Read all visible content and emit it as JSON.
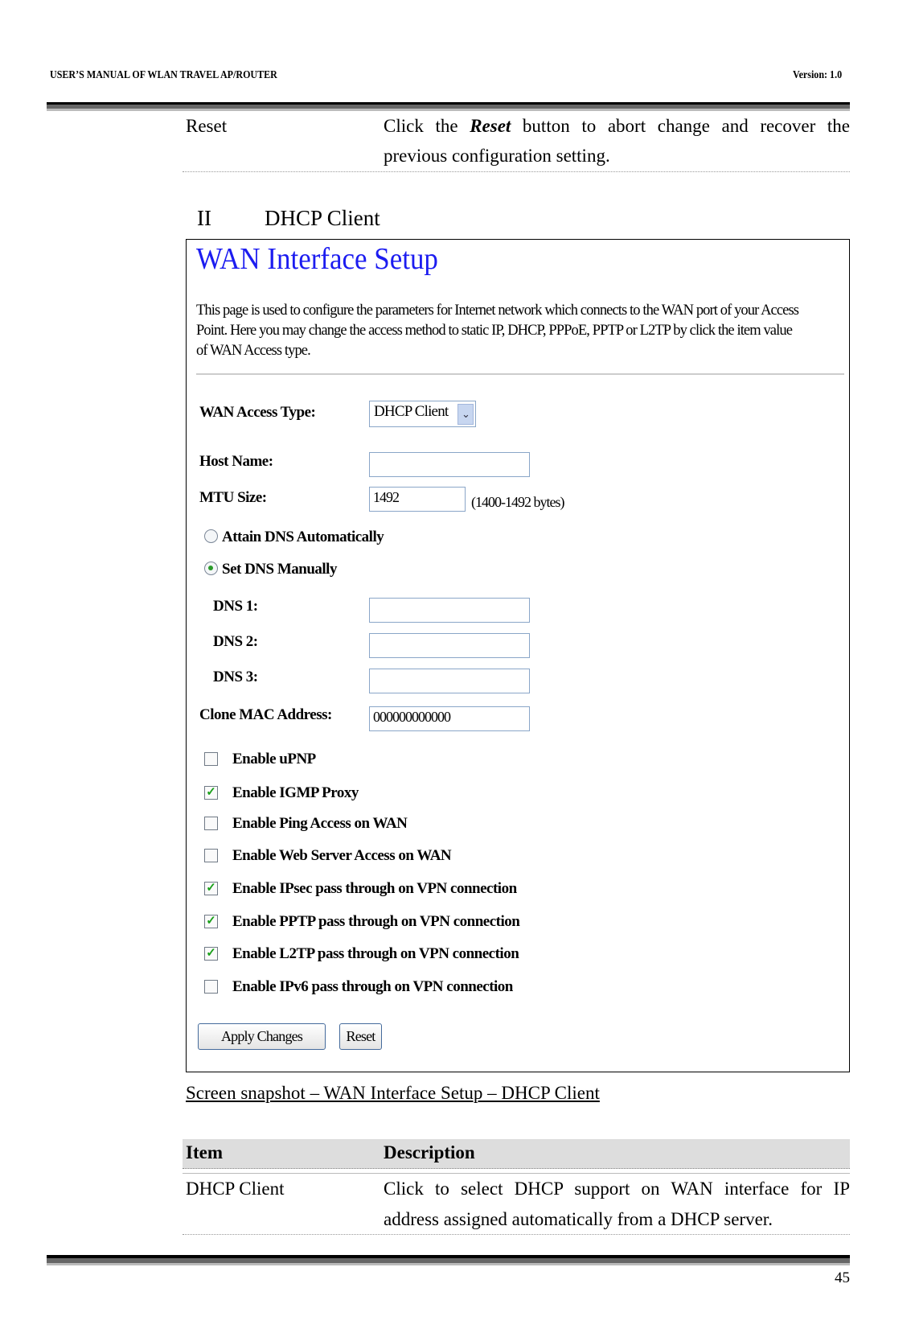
{
  "header": {
    "title": "USER’S MANUAL OF WLAN TRAVEL AP/ROUTER",
    "version": "Version: 1.0"
  },
  "reset_row": {
    "item": "Reset",
    "desc_pre": "Click the ",
    "desc_bold": "Reset",
    "desc_post": " button to abort change and recover the",
    "desc_line2": "previous configuration setting."
  },
  "section": {
    "number": "II",
    "title": "DHCP Client"
  },
  "screen": {
    "title": "WAN Interface Setup",
    "title_color": "#1c1cf0",
    "description": [
      "This page is used to configure the parameters for Internet network which connects to the WAN port of your Access",
      "Point. Here you may change the access method to static IP, DHCP, PPPoE, PPTP or L2TP by click the item value",
      "of WAN Access type."
    ],
    "wan_access_type_label": "WAN Access Type:",
    "wan_access_type_value": "DHCP Client",
    "host_name_label": "Host Name:",
    "host_name_value": "",
    "mtu_label": "MTU Size:",
    "mtu_value": "1492",
    "mtu_hint": "(1400-1492 bytes)",
    "dns_auto_label": "Attain DNS Automatically",
    "dns_manual_label": "Set DNS Manually",
    "dns_mode": "manual",
    "dns": [
      {
        "label": "DNS 1:",
        "value": ""
      },
      {
        "label": "DNS 2:",
        "value": ""
      },
      {
        "label": "DNS 3:",
        "value": ""
      }
    ],
    "clone_mac_label": "Clone MAC Address:",
    "clone_mac_value": "000000000000",
    "checkboxes": [
      {
        "label": "Enable uPNP",
        "checked": false
      },
      {
        "label": "Enable IGMP Proxy",
        "checked": true
      },
      {
        "label": "Enable Ping Access on WAN",
        "checked": false
      },
      {
        "label": "Enable Web Server Access on WAN",
        "checked": false
      },
      {
        "label": "Enable IPsec pass through on VPN connection",
        "checked": true
      },
      {
        "label": "Enable PPTP pass through on VPN connection",
        "checked": true
      },
      {
        "label": "Enable L2TP pass through on VPN connection",
        "checked": true
      },
      {
        "label": "Enable IPv6 pass through on VPN connection",
        "checked": false
      }
    ],
    "apply_label": "Apply Changes",
    "reset_label": "Reset"
  },
  "caption": "Screen snapshot – WAN Interface Setup – DHCP Client",
  "table": {
    "headers": [
      "Item",
      "Description"
    ],
    "rows": [
      {
        "item": "DHCP Client",
        "desc_line1": "Click to select DHCP support on WAN interface for IP",
        "desc_line2": "address assigned automatically from a DHCP server."
      }
    ]
  },
  "page_number": "45"
}
